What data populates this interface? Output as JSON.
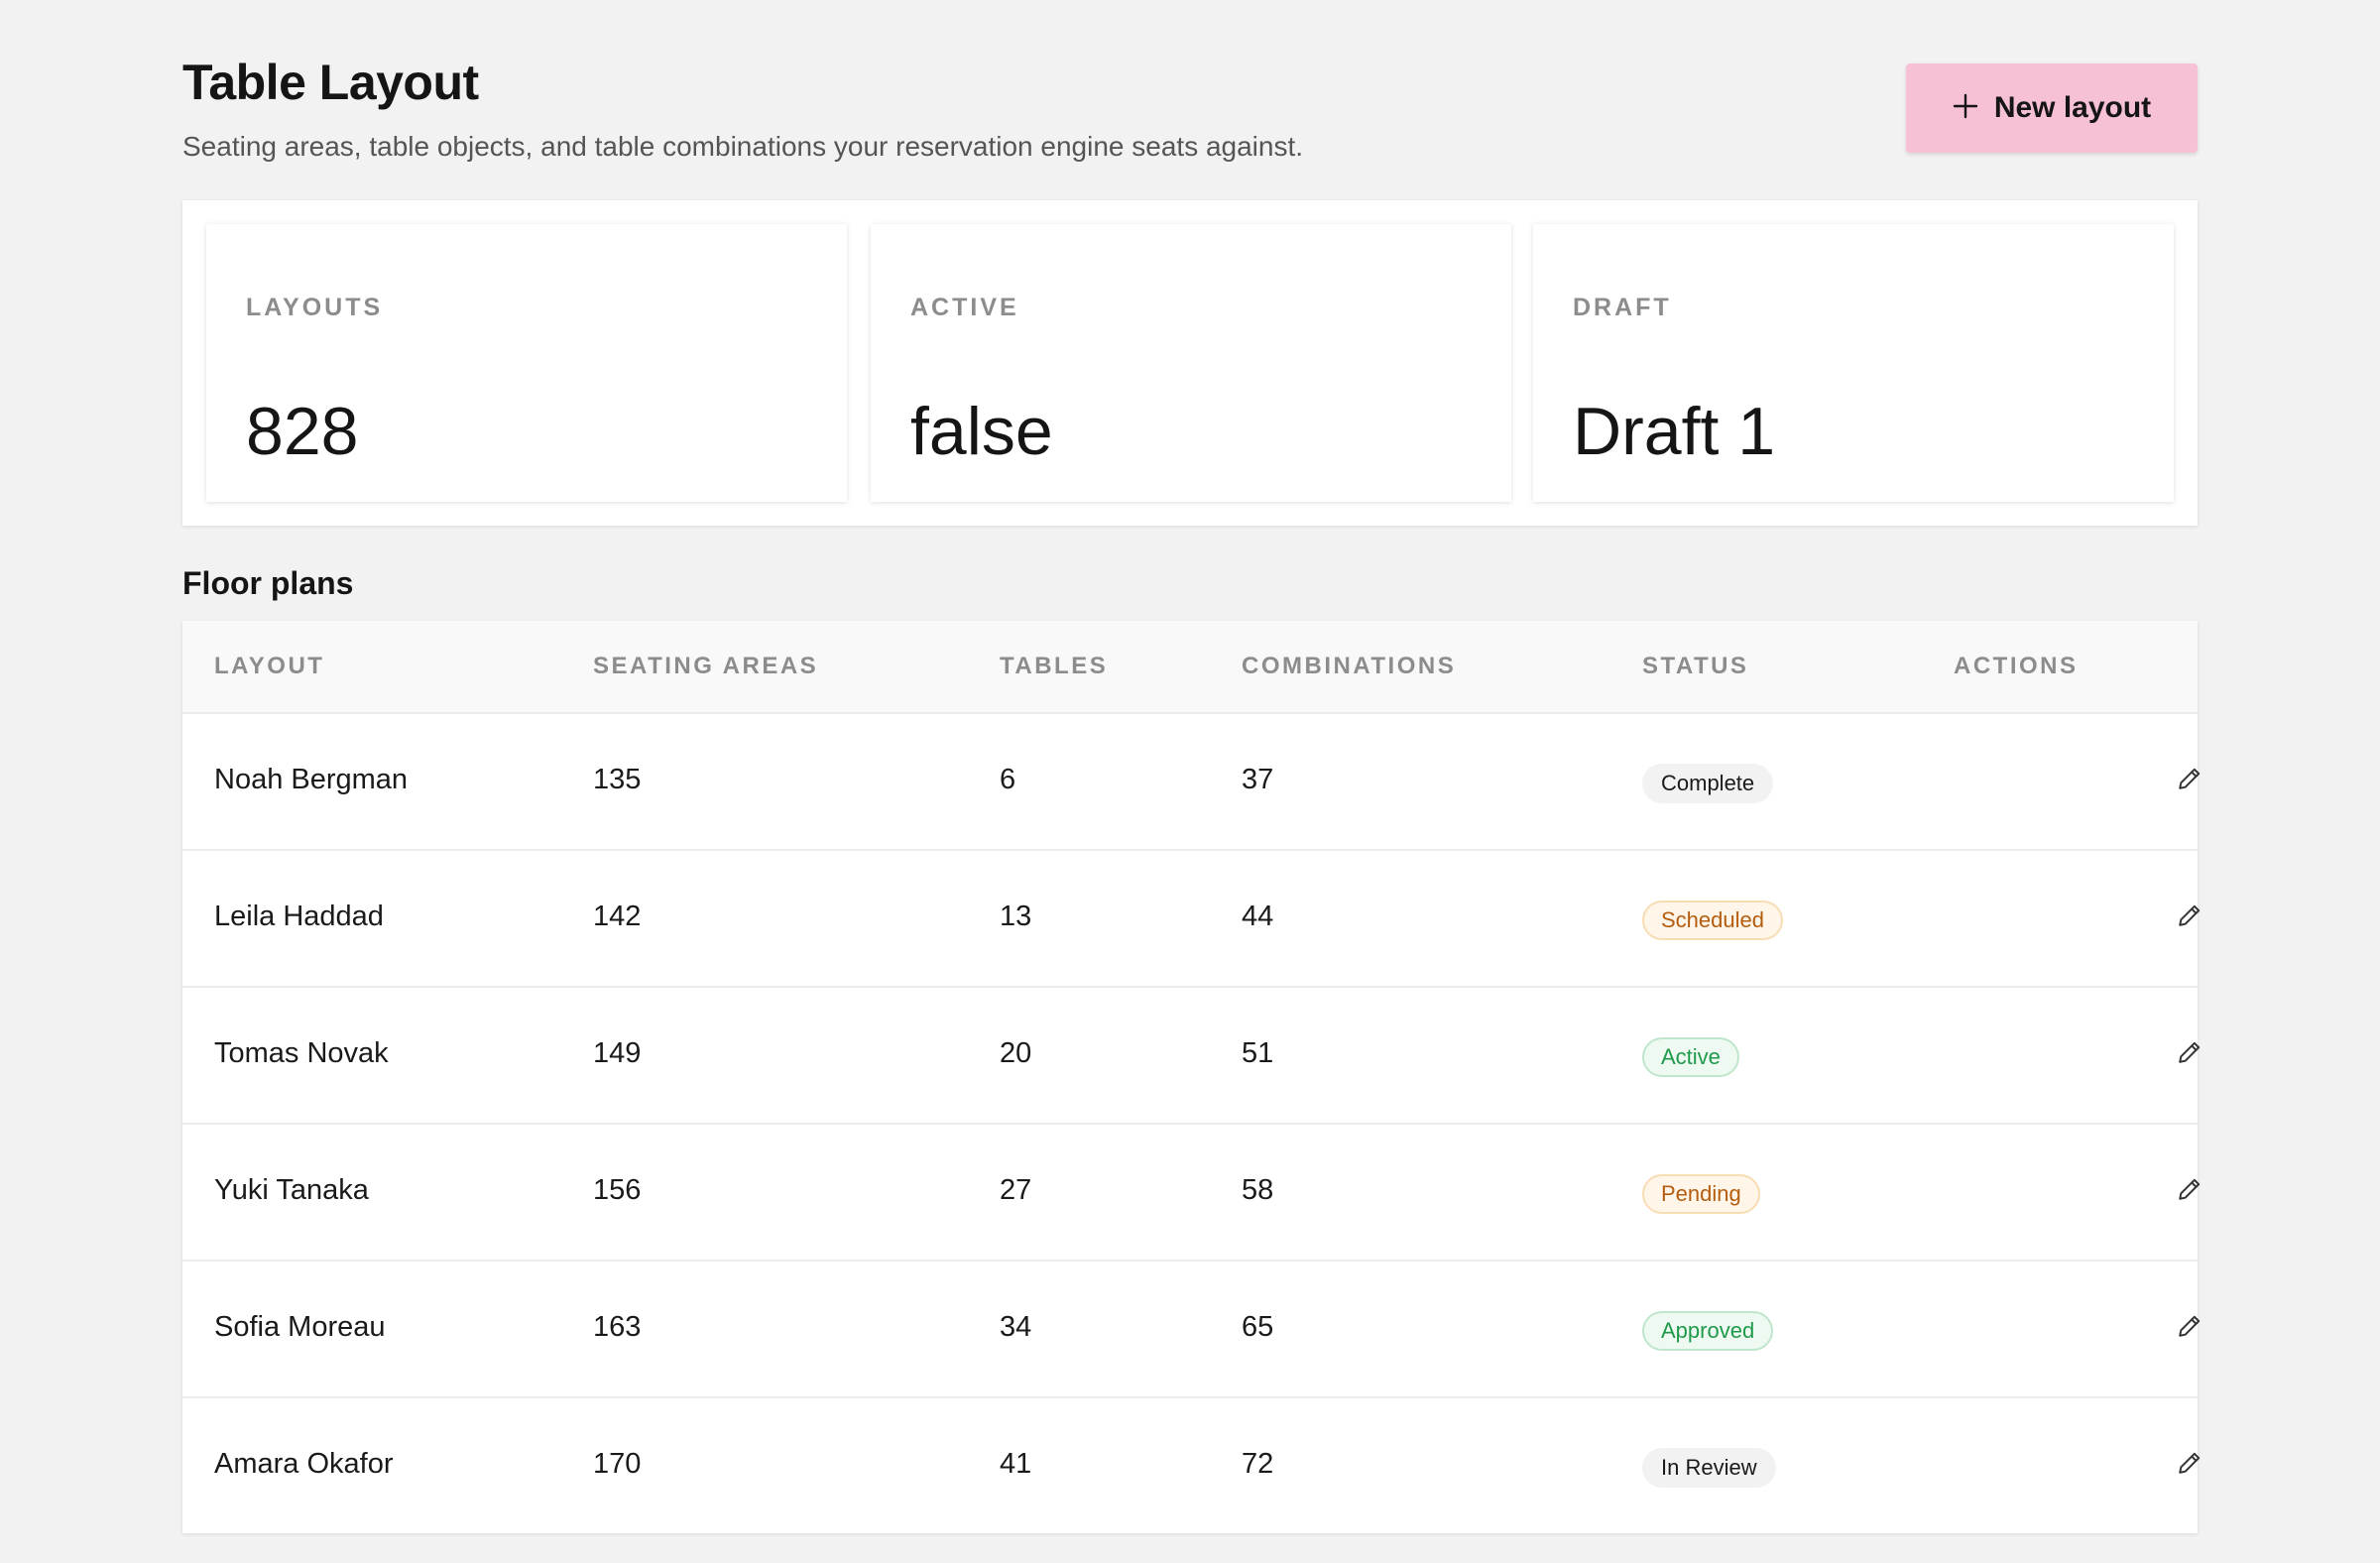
{
  "header": {
    "title": "Table Layout",
    "subtitle": "Seating areas, table objects, and table combinations your reservation engine seats against.",
    "new_button_label": "New layout",
    "new_button_icon": "plus-icon",
    "new_button_color": "#f6c1d7"
  },
  "stats": [
    {
      "label": "LAYOUTS",
      "value": "828"
    },
    {
      "label": "ACTIVE",
      "value": "false"
    },
    {
      "label": "DRAFT",
      "value": "Draft 1"
    }
  ],
  "floor_plans": {
    "title": "Floor plans",
    "columns": [
      "LAYOUT",
      "SEATING AREAS",
      "TABLES",
      "COMBINATIONS",
      "STATUS",
      "ACTIONS"
    ],
    "rows": [
      {
        "layout": "Noah Bergman",
        "seating_areas": "135",
        "tables": "6",
        "combinations": "37",
        "status": "Complete",
        "status_style": "neutral",
        "action_icon": "pencil-icon"
      },
      {
        "layout": "Leila Haddad",
        "seating_areas": "142",
        "tables": "13",
        "combinations": "44",
        "status": "Scheduled",
        "status_style": "warning",
        "action_icon": "pencil-icon"
      },
      {
        "layout": "Tomas Novak",
        "seating_areas": "149",
        "tables": "20",
        "combinations": "51",
        "status": "Active",
        "status_style": "success",
        "action_icon": "pencil-icon"
      },
      {
        "layout": "Yuki Tanaka",
        "seating_areas": "156",
        "tables": "27",
        "combinations": "58",
        "status": "Pending",
        "status_style": "warning",
        "action_icon": "pencil-icon"
      },
      {
        "layout": "Sofia Moreau",
        "seating_areas": "163",
        "tables": "34",
        "combinations": "65",
        "status": "Approved",
        "status_style": "success",
        "action_icon": "pencil-icon"
      },
      {
        "layout": "Amara Okafor",
        "seating_areas": "170",
        "tables": "41",
        "combinations": "72",
        "status": "In Review",
        "status_style": "neutral",
        "action_icon": "pencil-icon"
      }
    ]
  },
  "status_colors": {
    "neutral": {
      "bg": "#f2f2f2",
      "border": "#f2f2f2",
      "text": "#1a1a1a"
    },
    "warning": {
      "bg": "#fff5e8",
      "border": "#f8dcb4",
      "text": "#b45d0f"
    },
    "success": {
      "bg": "#edf9f1",
      "border": "#bfe6cc",
      "text": "#1f9a4a"
    }
  }
}
